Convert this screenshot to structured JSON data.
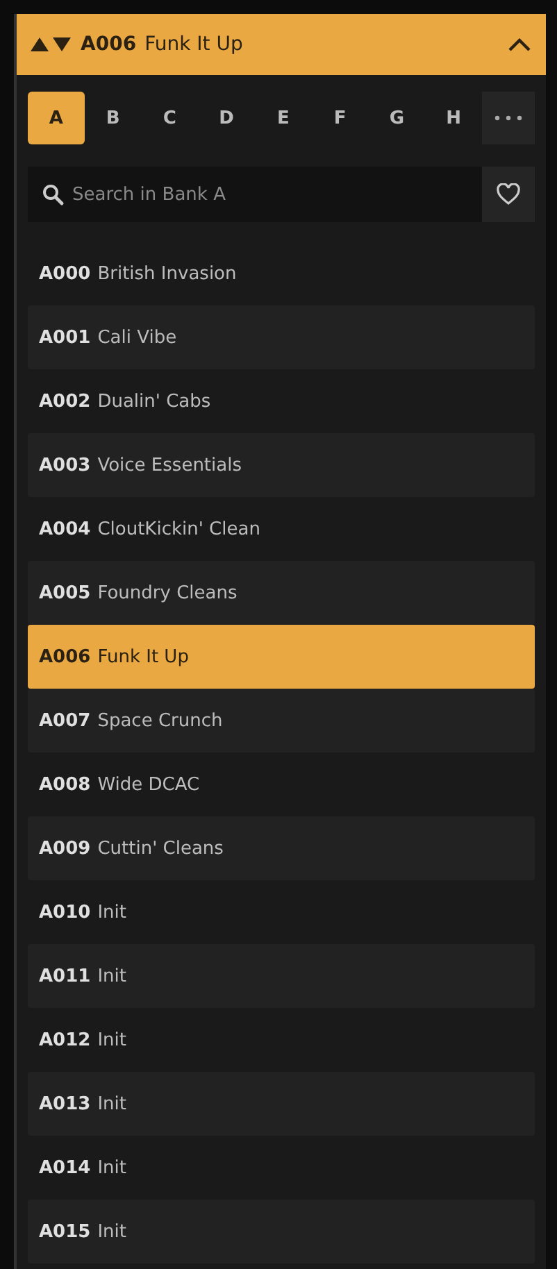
{
  "header": {
    "code": "A006",
    "name": "Funk It Up",
    "expanded": true
  },
  "banks": [
    {
      "label": "A",
      "selected": true
    },
    {
      "label": "B",
      "selected": false
    },
    {
      "label": "C",
      "selected": false
    },
    {
      "label": "D",
      "selected": false
    },
    {
      "label": "E",
      "selected": false
    },
    {
      "label": "F",
      "selected": false
    },
    {
      "label": "G",
      "selected": false
    },
    {
      "label": "H",
      "selected": false
    }
  ],
  "search": {
    "placeholder": "Search in Bank A"
  },
  "presets": [
    {
      "code": "A000",
      "name": "British Invasion",
      "selected": false
    },
    {
      "code": "A001",
      "name": "Cali Vibe",
      "selected": false
    },
    {
      "code": "A002",
      "name": "Dualin' Cabs",
      "selected": false
    },
    {
      "code": "A003",
      "name": "Voice Essentials",
      "selected": false
    },
    {
      "code": "A004",
      "name": "CloutKickin' Clean",
      "selected": false
    },
    {
      "code": "A005",
      "name": "Foundry Cleans",
      "selected": false
    },
    {
      "code": "A006",
      "name": "Funk It Up",
      "selected": true
    },
    {
      "code": "A007",
      "name": "Space Crunch",
      "selected": false
    },
    {
      "code": "A008",
      "name": "Wide DCAC",
      "selected": false
    },
    {
      "code": "A009",
      "name": "Cuttin' Cleans",
      "selected": false
    },
    {
      "code": "A010",
      "name": "Init",
      "selected": false
    },
    {
      "code": "A011",
      "name": "Init",
      "selected": false
    },
    {
      "code": "A012",
      "name": "Init",
      "selected": false
    },
    {
      "code": "A013",
      "name": "Init",
      "selected": false
    },
    {
      "code": "A014",
      "name": "Init",
      "selected": false
    },
    {
      "code": "A015",
      "name": "Init",
      "selected": false
    }
  ]
}
